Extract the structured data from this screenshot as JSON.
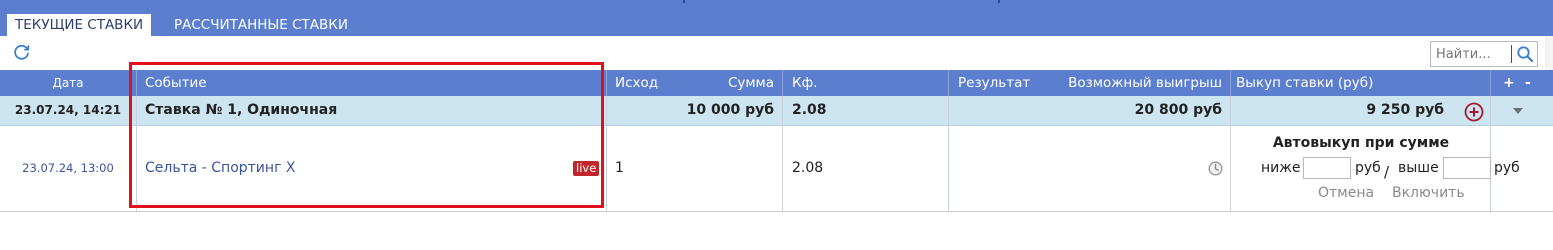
{
  "tabs": [
    {
      "label": "ТЕКУЩИЕ СТАВКИ",
      "active": true
    },
    {
      "label": "РАССЧИТАННЫЕ СТАВКИ",
      "active": false
    }
  ],
  "search": {
    "placeholder": "Найти..."
  },
  "columns": {
    "date": "Дата",
    "event": "Событие",
    "outcome": "Исход",
    "amount": "Сумма",
    "coef": "Кф.",
    "result": "Результат",
    "possible_win": "Возможный выигрыш",
    "buyout": "Выкуп ставки (руб)",
    "expand_all": "+",
    "collapse_all": "-"
  },
  "bet": {
    "date": "23.07.24, 14:21",
    "title": "Ставка № 1, Одиночная",
    "amount": "10 000 руб",
    "coef": "2.08",
    "possible_win": "20 800 руб",
    "buyout": "9 250 руб"
  },
  "event": {
    "date": "23.07.24, 13:00",
    "name": "Сельта - Спортинг Х",
    "badge": "live",
    "outcome": "1",
    "coef": "2.08"
  },
  "autobuyout": {
    "title": "Автовыкуп при сумме",
    "below_label": "ниже",
    "below_unit": "руб",
    "divider": "/",
    "above_label": "выше",
    "above_unit": "руб",
    "cancel": "Отмена",
    "enable": "Включить"
  },
  "colors": {
    "accent": "#5b7fce",
    "row_highlight": "#cde4f1",
    "live_badge": "#c0272d",
    "annotation": "#e0111a"
  }
}
